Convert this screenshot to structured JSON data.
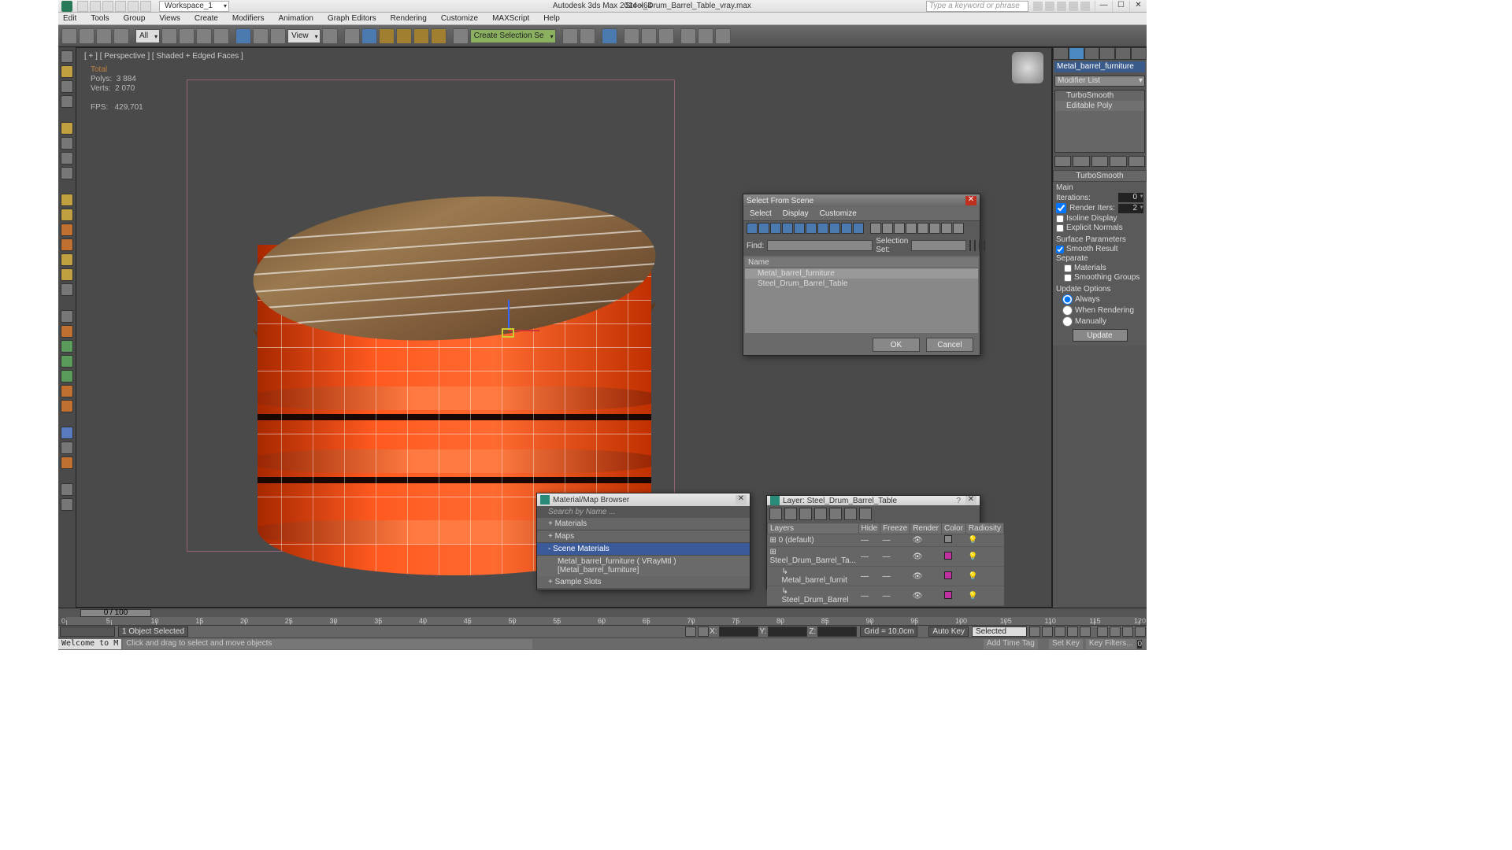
{
  "titlebar": {
    "workspace": "Workspace_1",
    "app": "Autodesk 3ds Max  2014 x64",
    "file": "Steel_Drum_Barrel_Table_vray.max",
    "search_placeholder": "Type a keyword or phrase"
  },
  "menu": [
    "Edit",
    "Tools",
    "Group",
    "Views",
    "Create",
    "Modifiers",
    "Animation",
    "Graph Editors",
    "Rendering",
    "Customize",
    "MAXScript",
    "Help"
  ],
  "toolbar": {
    "filter": "All",
    "view": "View",
    "sel": "Create Selection Se"
  },
  "viewport": {
    "label": "[ + ] [ Perspective ] [ Shaded + Edged Faces ]",
    "stats_header": "Total",
    "polys_label": "Polys:",
    "polys": "3 884",
    "verts_label": "Verts:",
    "verts": "2 070",
    "fps_label": "FPS:",
    "fps": "429,701"
  },
  "sfs": {
    "title": "Select From Scene",
    "menu": [
      "Select",
      "Display",
      "Customize"
    ],
    "find": "Find:",
    "selset": "Selection Set:",
    "col": "Name",
    "items": [
      "Metal_barrel_furniture",
      "Steel_Drum_Barrel_Table"
    ],
    "ok": "OK",
    "cancel": "Cancel"
  },
  "cmd": {
    "obj": "Metal_barrel_furniture",
    "modlist": "Modifier List",
    "stack": [
      "TurboSmooth",
      "Editable Poly"
    ],
    "rollout": "TurboSmooth",
    "main": "Main",
    "iter_l": "Iterations:",
    "iter_v": "0",
    "rend_l": "Render Iters:",
    "rend_v": "2",
    "iso": "Isoline Display",
    "expn": "Explicit Normals",
    "surf": "Surface Parameters",
    "smooth": "Smooth Result",
    "sep": "Separate",
    "mats": "Materials",
    "sg": "Smoothing Groups",
    "upd": "Update Options",
    "always": "Always",
    "when": "When Rendering",
    "man": "Manually",
    "updbtn": "Update"
  },
  "matb": {
    "title": "Material/Map Browser",
    "search": "Search by Name ...",
    "nodes": [
      "+ Materials",
      "+ Maps",
      "- Scene Materials"
    ],
    "leaf": "Metal_barrel_furniture ( VRayMtl )  [Metal_barrel_furniture]",
    "last": "+ Sample Slots"
  },
  "layer": {
    "title": "Layer: Steel_Drum_Barrel_Table",
    "cols": [
      "Layers",
      "Hide",
      "Freeze",
      "Render",
      "Color",
      "Radiosity"
    ],
    "rows": [
      {
        "name": "0 (default)",
        "indent": 0
      },
      {
        "name": "Steel_Drum_Barrel_Ta...",
        "indent": 0
      },
      {
        "name": "Metal_barrel_furnit",
        "indent": 1
      },
      {
        "name": "Steel_Drum_Barrel",
        "indent": 1
      }
    ]
  },
  "timeline": {
    "pos": "0 / 100",
    "ticks": [
      0,
      5,
      10,
      15,
      20,
      25,
      30,
      35,
      40,
      45,
      50,
      55,
      60,
      65,
      70,
      75,
      80,
      85,
      90,
      95,
      100,
      105,
      110,
      115,
      120
    ]
  },
  "status": {
    "objsel": "1 Object Selected",
    "x": "X:",
    "y": "Y:",
    "z": "Z:",
    "grid": "Grid = 10,0cm",
    "autokey": "Auto Key",
    "selected": "Selected",
    "setkey": "Set Key",
    "keyf": "Key Filters...",
    "welcome": "Welcome to M",
    "hint": "Click and drag to select and move objects",
    "addtag": "Add Time Tag"
  }
}
